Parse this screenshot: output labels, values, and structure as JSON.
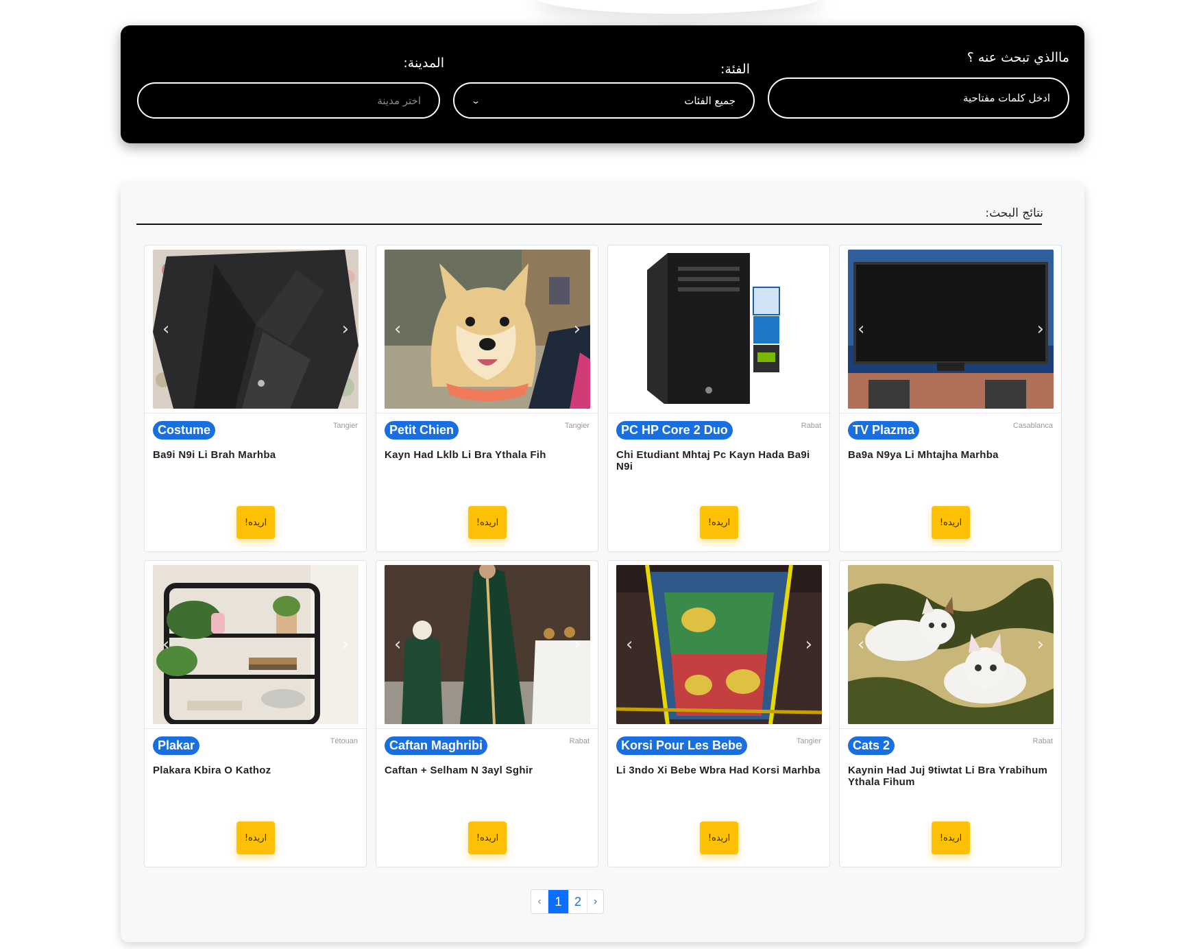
{
  "search": {
    "keyword_label": "ماالذي تبحث عنه ؟",
    "keyword_placeholder": "ادخل كلمات مفتاحية",
    "category_label": "الفئة:",
    "category_value": "جميع الفئات",
    "city_label": "المدينة:",
    "city_placeholder": "اختر مدينة"
  },
  "results": {
    "title": "نتائج البحث:",
    "want_label": "اريده!",
    "items": [
      {
        "title": "Costume",
        "city": "Tangier",
        "desc": "Ba9i N9i Li Brah Marhba",
        "image": "suit"
      },
      {
        "title": "Petit Chien",
        "city": "Tangier",
        "desc": "Kayn Had Lklb Li Bra Ythala Fih",
        "image": "dog"
      },
      {
        "title": "PC HP Core 2 Duo",
        "city": "Rabat",
        "desc": "Chi Etudiant Mhtaj Pc Kayn Hada Ba9i N9i",
        "image": "pc"
      },
      {
        "title": "TV Plazma",
        "city": "Casablanca",
        "desc": "Ba9a N9ya Li Mhtajha Marhba",
        "image": "tv"
      },
      {
        "title": "Plakar",
        "city": "Tétouan",
        "desc": "Plakara Kbira O Kathoz",
        "image": "shelf"
      },
      {
        "title": "Caftan Maghribi",
        "city": "Rabat",
        "desc": "Caftan + Selham N 3ayl Sghir",
        "image": "caftan"
      },
      {
        "title": "Korsi Pour Les Bebe",
        "city": "Tangier",
        "desc": "Li 3ndo Xi Bebe Wbra Had Korsi Marhba",
        "image": "stroller"
      },
      {
        "title": "Cats 2",
        "city": "Rabat",
        "desc": "Kaynin Had Juj 9tiwtat Li Bra Yrabihum Ythala Fihum",
        "image": "cats"
      }
    ]
  },
  "pagination": {
    "prev": "‹",
    "pages": [
      "1",
      "2"
    ],
    "next": "›",
    "active": "1"
  },
  "colors": {
    "badge": "#1a6fe0",
    "button": "#ffc107",
    "panel": "#000000"
  }
}
